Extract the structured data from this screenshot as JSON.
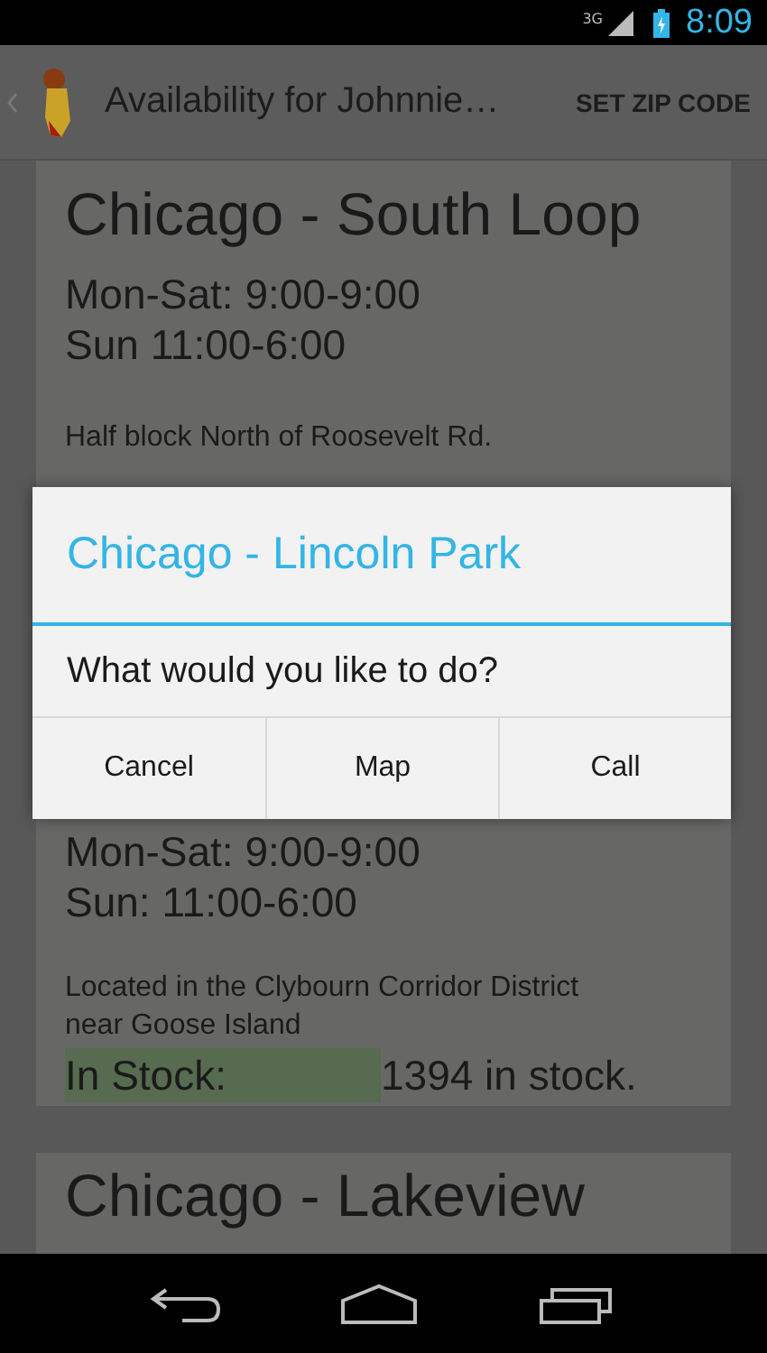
{
  "status_bar": {
    "network": "3G",
    "time": "8:09"
  },
  "action_bar": {
    "title": "Availability for Johnnie…",
    "action": "SET ZIP CODE"
  },
  "stores": [
    {
      "name": "Chicago - South Loop",
      "hours": [
        "Mon-Sat: 9:00-9:00",
        "Sun 11:00-6:00"
      ],
      "address": "Half block North of Roosevelt Rd."
    },
    {
      "hours": [
        "Mon-Sat: 9:00-9:00",
        "Sun: 11:00-6:00"
      ],
      "address": "Located in the Clybourn Corridor District near Goose Island",
      "stock_label": "In Stock:",
      "stock": "1394 in stock."
    },
    {
      "name": "Chicago - Lakeview"
    }
  ],
  "dialog": {
    "title": "Chicago - Lincoln Park",
    "message": "What would you like to do?",
    "buttons": [
      "Cancel",
      "Map",
      "Call"
    ]
  }
}
